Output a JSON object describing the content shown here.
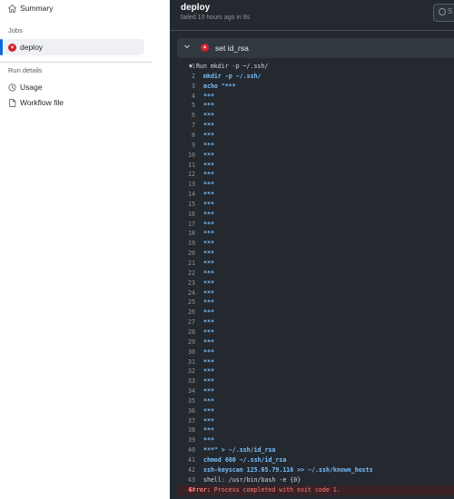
{
  "sidebar": {
    "summary_label": "Summary",
    "jobs_header": "Jobs",
    "jobs": [
      {
        "label": "deploy",
        "status": "failed"
      }
    ],
    "run_details_header": "Run details",
    "usage_label": "Usage",
    "workflow_file_label": "Workflow file"
  },
  "job": {
    "title": "deploy",
    "status_text": "failed 10 hours ago in 8s"
  },
  "search": {
    "placeholder": "S"
  },
  "step": {
    "name": "set id_rsa",
    "status": "failed"
  },
  "log_lines": [
    {
      "n": "1",
      "text": "▼ Run mkdir -p ~/.ssh/",
      "kind": "run"
    },
    {
      "n": "2",
      "text": "mkdir -p ~/.ssh/",
      "kind": "cmd"
    },
    {
      "n": "3",
      "text": "echo \"***",
      "kind": "cmd"
    },
    {
      "n": "4",
      "text": "***",
      "kind": "cmd"
    },
    {
      "n": "5",
      "text": "***",
      "kind": "cmd"
    },
    {
      "n": "6",
      "text": "***",
      "kind": "cmd"
    },
    {
      "n": "7",
      "text": "***",
      "kind": "cmd"
    },
    {
      "n": "8",
      "text": "***",
      "kind": "cmd"
    },
    {
      "n": "9",
      "text": "***",
      "kind": "cmd"
    },
    {
      "n": "10",
      "text": "***",
      "kind": "cmd"
    },
    {
      "n": "11",
      "text": "***",
      "kind": "cmd"
    },
    {
      "n": "12",
      "text": "***",
      "kind": "cmd"
    },
    {
      "n": "13",
      "text": "***",
      "kind": "cmd"
    },
    {
      "n": "14",
      "text": "***",
      "kind": "cmd"
    },
    {
      "n": "15",
      "text": "***",
      "kind": "cmd"
    },
    {
      "n": "16",
      "text": "***",
      "kind": "cmd"
    },
    {
      "n": "17",
      "text": "***",
      "kind": "cmd"
    },
    {
      "n": "18",
      "text": "***",
      "kind": "cmd"
    },
    {
      "n": "19",
      "text": "***",
      "kind": "cmd"
    },
    {
      "n": "20",
      "text": "***",
      "kind": "cmd"
    },
    {
      "n": "21",
      "text": "***",
      "kind": "cmd"
    },
    {
      "n": "22",
      "text": "***",
      "kind": "cmd"
    },
    {
      "n": "23",
      "text": "***",
      "kind": "cmd"
    },
    {
      "n": "24",
      "text": "***",
      "kind": "cmd"
    },
    {
      "n": "25",
      "text": "***",
      "kind": "cmd"
    },
    {
      "n": "26",
      "text": "***",
      "kind": "cmd"
    },
    {
      "n": "27",
      "text": "***",
      "kind": "cmd"
    },
    {
      "n": "28",
      "text": "***",
      "kind": "cmd"
    },
    {
      "n": "29",
      "text": "***",
      "kind": "cmd"
    },
    {
      "n": "30",
      "text": "***",
      "kind": "cmd"
    },
    {
      "n": "31",
      "text": "***",
      "kind": "cmd"
    },
    {
      "n": "32",
      "text": "***",
      "kind": "cmd"
    },
    {
      "n": "33",
      "text": "***",
      "kind": "cmd"
    },
    {
      "n": "34",
      "text": "***",
      "kind": "cmd"
    },
    {
      "n": "35",
      "text": "***",
      "kind": "cmd"
    },
    {
      "n": "36",
      "text": "***",
      "kind": "cmd"
    },
    {
      "n": "37",
      "text": "***",
      "kind": "cmd"
    },
    {
      "n": "38",
      "text": "***",
      "kind": "cmd"
    },
    {
      "n": "39",
      "text": "***",
      "kind": "cmd"
    },
    {
      "n": "40",
      "text": "***\" > ~/.ssh/id_rsa",
      "kind": "cmd"
    },
    {
      "n": "41",
      "text": "chmod 600 ~/.ssh/id_rsa",
      "kind": "cmd"
    },
    {
      "n": "42",
      "text": "ssh-keyscan 125.65.79.116 >> ~/.ssh/known_hosts",
      "kind": "cmd"
    },
    {
      "n": "43",
      "text": "shell: /usr/bin/bash -e {0}",
      "kind": "plain"
    },
    {
      "n": "44",
      "error_label": "Error:",
      "text": " Process completed with exit code 1.",
      "kind": "error"
    }
  ],
  "colors": {
    "failed": "#cf222e",
    "selected_bar": "#0969da",
    "log_bg": "#24292f",
    "cmd": "#79c0ff",
    "error": "#ff7b72"
  }
}
